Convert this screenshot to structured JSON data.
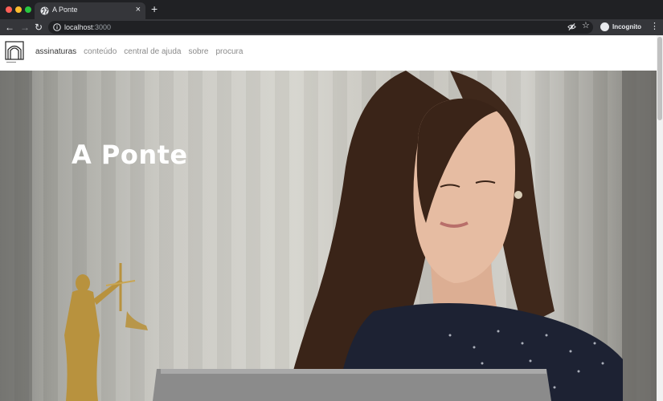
{
  "browser": {
    "tab_title": "A Ponte",
    "tab_close": "×",
    "new_tab": "+",
    "url_host": "localhost",
    "url_port": ":3000",
    "incognito_label": "Incognito",
    "icons": {
      "back": "back-arrow-icon",
      "forward": "forward-arrow-icon",
      "reload": "reload-icon",
      "info": "info-icon",
      "eye": "eye-off-icon",
      "star": "star-icon",
      "menu": "kebab-menu-icon"
    }
  },
  "site": {
    "nav": [
      {
        "label": "assinaturas",
        "active": true
      },
      {
        "label": "conteúdo",
        "active": false
      },
      {
        "label": "central de ajuda",
        "active": false
      },
      {
        "label": "sobre",
        "active": false
      },
      {
        "label": "procura",
        "active": false
      }
    ],
    "hero_title": "A Ponte"
  },
  "colors": {
    "tab_bar": "#202124",
    "toolbar": "#35363a",
    "header_bg": "#ffffff",
    "nav_active": "#333333",
    "nav_inactive": "#8a8a8a"
  }
}
